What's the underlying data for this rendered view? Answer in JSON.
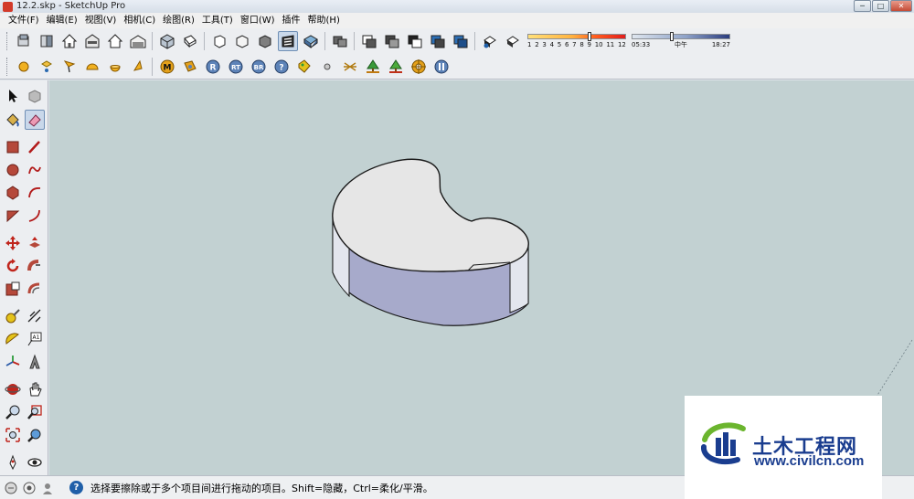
{
  "window": {
    "title": "12.2.skp - SketchUp Pro",
    "controls": [
      "─",
      "□",
      "✕"
    ]
  },
  "menu": {
    "items": [
      "文件(F)",
      "编辑(E)",
      "视图(V)",
      "相机(C)",
      "绘图(R)",
      "工具(T)",
      "窗口(W)",
      "插件",
      "帮助(H)"
    ]
  },
  "shadow": {
    "month_ticks": [
      "1",
      "2",
      "3",
      "4",
      "5",
      "6",
      "7",
      "8",
      "9",
      "10",
      "11",
      "12"
    ],
    "sunrise": "05:33",
    "noon": "中午",
    "sunset": "18:27"
  },
  "toolbar_icons": {
    "row1": [
      "get-models",
      "share-model",
      "house",
      "building",
      "house-outline",
      "warehouse",
      "iso-view",
      "top-view",
      "front-view",
      "right-view",
      "back-view",
      "left-view",
      "xray",
      "wireframe",
      "hidden-line",
      "shaded",
      "shaded-texture",
      "monochrome",
      "section-plane",
      "section-display",
      "section-cuts",
      "component-edit",
      "component-hide",
      "shadows",
      "fog"
    ],
    "row2": [
      "sphere",
      "sun-point",
      "flag",
      "dome",
      "half-sphere",
      "cone",
      "M",
      "paint-roll",
      "R",
      "RT",
      "BR",
      "help",
      "tag",
      "dot",
      "cross",
      "tree",
      "tree-2",
      "target",
      "pause"
    ]
  },
  "palette_tools": [
    "select-tool",
    "make-component-tool",
    "paint-bucket-tool",
    "eraser-tool",
    "rectangle-tool",
    "line-tool",
    "circle-tool",
    "arc-tool",
    "polygon-tool",
    "freehand-tool",
    "polygon-2-tool",
    "arc-2-tool",
    "move-tool",
    "push-pull-tool",
    "rotate-tool",
    "follow-me-tool",
    "scale-tool",
    "offset-tool",
    "tape-measure-tool",
    "dimension-tool",
    "protractor-tool",
    "text-tool",
    "axes-tool",
    "3d-text-tool",
    "orbit-tool",
    "pan-tool",
    "zoom-tool",
    "zoom-window-tool",
    "zoom-extents-tool",
    "previous-view-tool",
    "position-camera-tool",
    "look-around-tool"
  ],
  "status": {
    "text": "选择要擦除或于多个项目间进行拖动的项目。Shift=隐藏，Ctrl=柔化/平滑。"
  },
  "watermark": {
    "title": "土木工程网",
    "url": "www.civilcn.com"
  },
  "colors": {
    "viewport": "#c2d1d2",
    "top_face": "#e6e6e6",
    "side_face": "#a7aacb",
    "watermark_blue": "#1a3d8f",
    "watermark_green": "#6bb52e"
  }
}
